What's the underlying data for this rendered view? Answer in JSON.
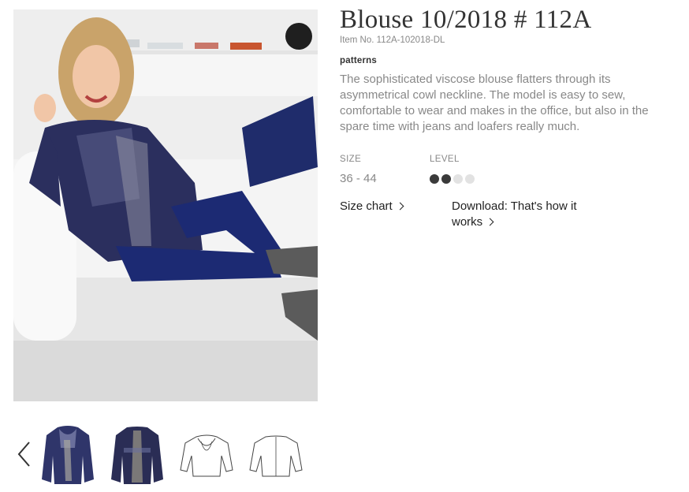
{
  "product": {
    "title": "Blouse 10/2018 # 112A",
    "item_no": "Item No. 112A-102018-DL",
    "category": "patterns",
    "description": "The sophisticated viscose blouse flatters through its asymmetrical cowl neckline. The model is easy to sew, comfortable to wear and makes in the office, but also in the spare time with jeans and loafers really much."
  },
  "specs": {
    "size_label": "SIZE",
    "size_value": "36 - 44",
    "level_label": "LEVEL",
    "level_value": 2,
    "level_max": 4
  },
  "links": {
    "size_chart": "Size chart",
    "download_line1": "Download: That's how it",
    "download_line2": "works"
  },
  "gallery": {
    "main_image": "model-wearing-blouse-photo",
    "thumbnails": [
      "blouse-front-photo",
      "blouse-back-photo",
      "blouse-front-sketch",
      "blouse-back-sketch"
    ]
  },
  "colors": {
    "text_dark": "#333333",
    "text_muted": "#888888",
    "level_on": "#3a3a3a",
    "level_off": "#e2e2e2",
    "fabric_navy": "#2b2f5e"
  }
}
